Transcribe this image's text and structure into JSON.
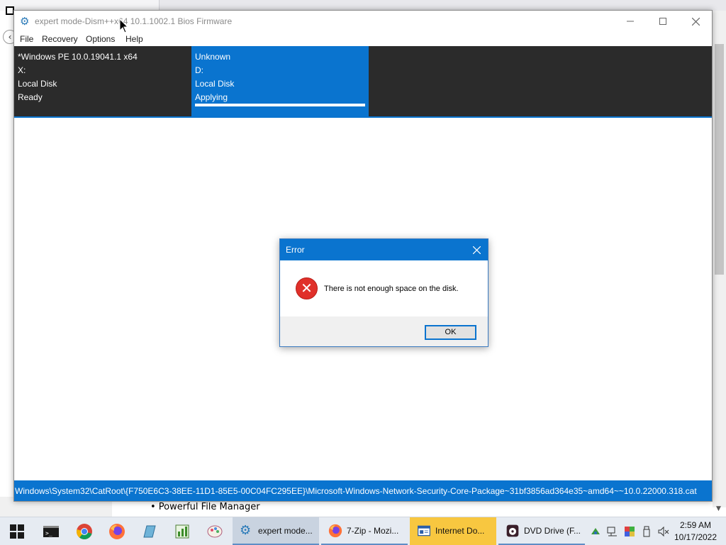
{
  "window": {
    "title": "expert mode-Dism++x64 10.1.1002.1 Bios Firmware"
  },
  "menu": {
    "items": [
      "File",
      "Recovery",
      "Options",
      "Help"
    ]
  },
  "images": [
    {
      "name": "*Windows PE 10.0.19041.1 x64",
      "drive": "X:",
      "type": "Local Disk",
      "status": "Ready",
      "selected": false
    },
    {
      "name": "Unknown",
      "drive": "D:",
      "type": "Local Disk",
      "status": "Applying",
      "selected": true,
      "progress": 1.0
    }
  ],
  "statusbar": {
    "text": "Windows\\System32\\CatRoot\\{F750E6C3-38EE-11D1-85E5-00C04FC295EE}\\Microsoft-Windows-Network-Security-Core-Package~31bf3856ad364e35~amd64~~10.0.22000.318.cat"
  },
  "dialog": {
    "title": "Error",
    "message": "There is not enough space on the disk.",
    "ok_label": "OK",
    "icon": "error-icon"
  },
  "background": {
    "bullet": "• Powerful File Manager"
  },
  "taskbar": {
    "apps": [
      {
        "label": "expert mode...",
        "icon": "dism-icon",
        "active": true
      },
      {
        "label": "7-Zip - Mozi...",
        "icon": "firefox-icon",
        "active": false
      },
      {
        "label": "Internet Do...",
        "icon": "document-icon",
        "active": false
      },
      {
        "label": "DVD Drive (F...",
        "icon": "dvd-icon",
        "active": false
      }
    ],
    "clock": {
      "time": "2:59 AM",
      "date": "10/17/2022"
    }
  },
  "colors": {
    "accent": "#0a74cf",
    "panel_dark": "#2b2b2b",
    "error_red": "#e0302a",
    "taskbar_highlight": "#f8c740"
  }
}
